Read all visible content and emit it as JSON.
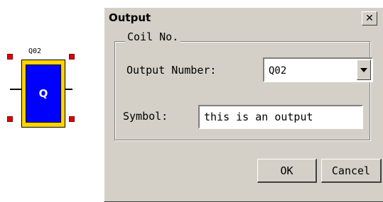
{
  "symbol": {
    "tag": "Q02",
    "letter": "Q",
    "colors": {
      "fill": "#ffd400",
      "inner": "#0000ff",
      "handles": "#e00000"
    }
  },
  "dialog": {
    "title": "Output",
    "close_icon": "close-icon",
    "group_label": "Coil No.",
    "output_number_label": "Output Number:",
    "output_number_value": "Q02",
    "symbol_label": "Symbol:",
    "symbol_value": "this is an output",
    "ok_label": "OK",
    "cancel_label": "Cancel"
  }
}
